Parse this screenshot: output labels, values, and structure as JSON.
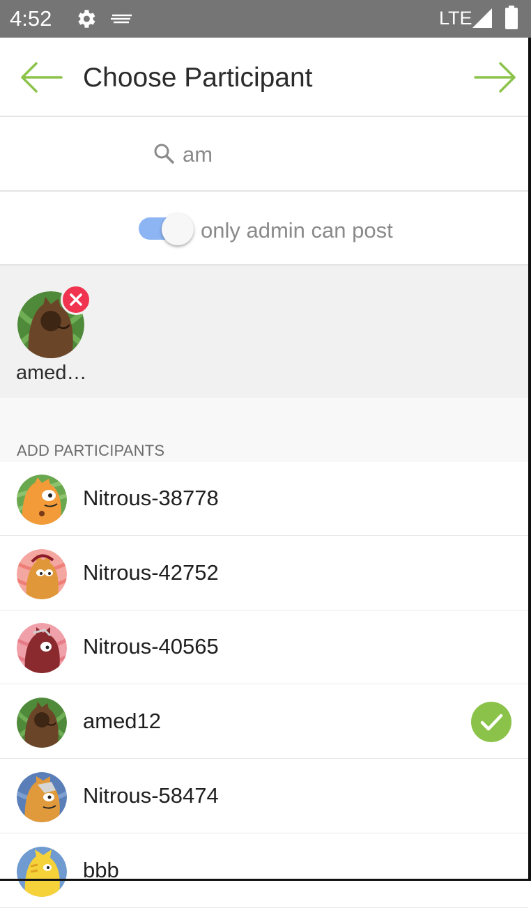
{
  "status_bar": {
    "time": "4:52",
    "network": "LTE",
    "icons": [
      "settings-gear-icon",
      "notification-icon",
      "signal-icon",
      "battery-icon"
    ]
  },
  "app_bar": {
    "title": "Choose Participant",
    "back_icon": "arrow-left-icon",
    "next_icon": "arrow-right-icon"
  },
  "search": {
    "value": "am",
    "icon": "search-icon"
  },
  "toggle": {
    "label": "only admin can post",
    "state": "on"
  },
  "selected": [
    {
      "label": "amed…",
      "avatar": "cat-avatar-brown-green"
    }
  ],
  "section": {
    "header": "ADD PARTICIPANTS"
  },
  "participants": [
    {
      "name": "Nitrous-38778",
      "avatar": "cat-avatar-orange-green",
      "checked": false
    },
    {
      "name": "Nitrous-42752",
      "avatar": "cat-avatar-orange-pink",
      "checked": false
    },
    {
      "name": "Nitrous-40565",
      "avatar": "cat-avatar-maroon-pink",
      "checked": false
    },
    {
      "name": "amed12",
      "avatar": "cat-avatar-brown-green",
      "checked": true
    },
    {
      "name": "Nitrous-58474",
      "avatar": "cat-avatar-orange-blue",
      "checked": false
    },
    {
      "name": "bbb",
      "avatar": "cat-avatar-yellow-blue",
      "checked": false
    }
  ],
  "colors": {
    "accent_green": "#8bc34a",
    "remove_red": "#f0344f",
    "toggle_blue": "#8db5f4",
    "status_bar": "#757575"
  }
}
